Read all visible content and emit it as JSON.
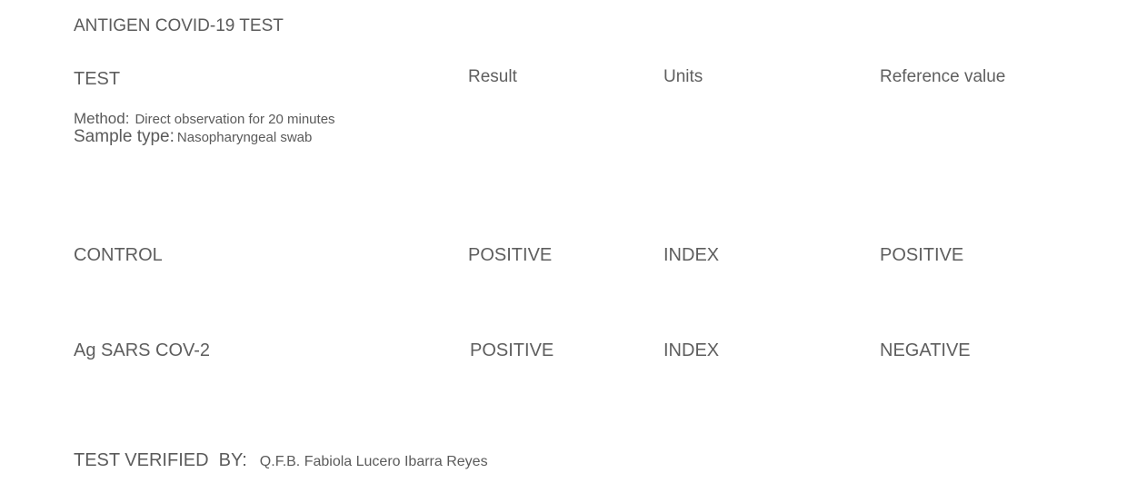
{
  "document": {
    "title": "ANTIGEN COVID-19 TEST"
  },
  "table": {
    "headers": {
      "test": "TEST",
      "result": "Result",
      "units": "Units",
      "reference": "Reference value"
    },
    "method_label": "Method:",
    "method_value": "Direct observation for 20 minutes",
    "sample_label": "Sample type:",
    "sample_value": "Nasopharyngeal swab",
    "rows": [
      {
        "test": "CONTROL",
        "result": "POSITIVE",
        "units": "INDEX",
        "reference": "POSITIVE"
      },
      {
        "test": "Ag SARS COV-2",
        "result": "POSITIVE",
        "units": "INDEX",
        "reference": "NEGATIVE"
      }
    ]
  },
  "verification": {
    "label": "TEST VERIFIED  BY:",
    "name": "Q.F.B. Fabiola Lucero Ibarra Reyes"
  }
}
